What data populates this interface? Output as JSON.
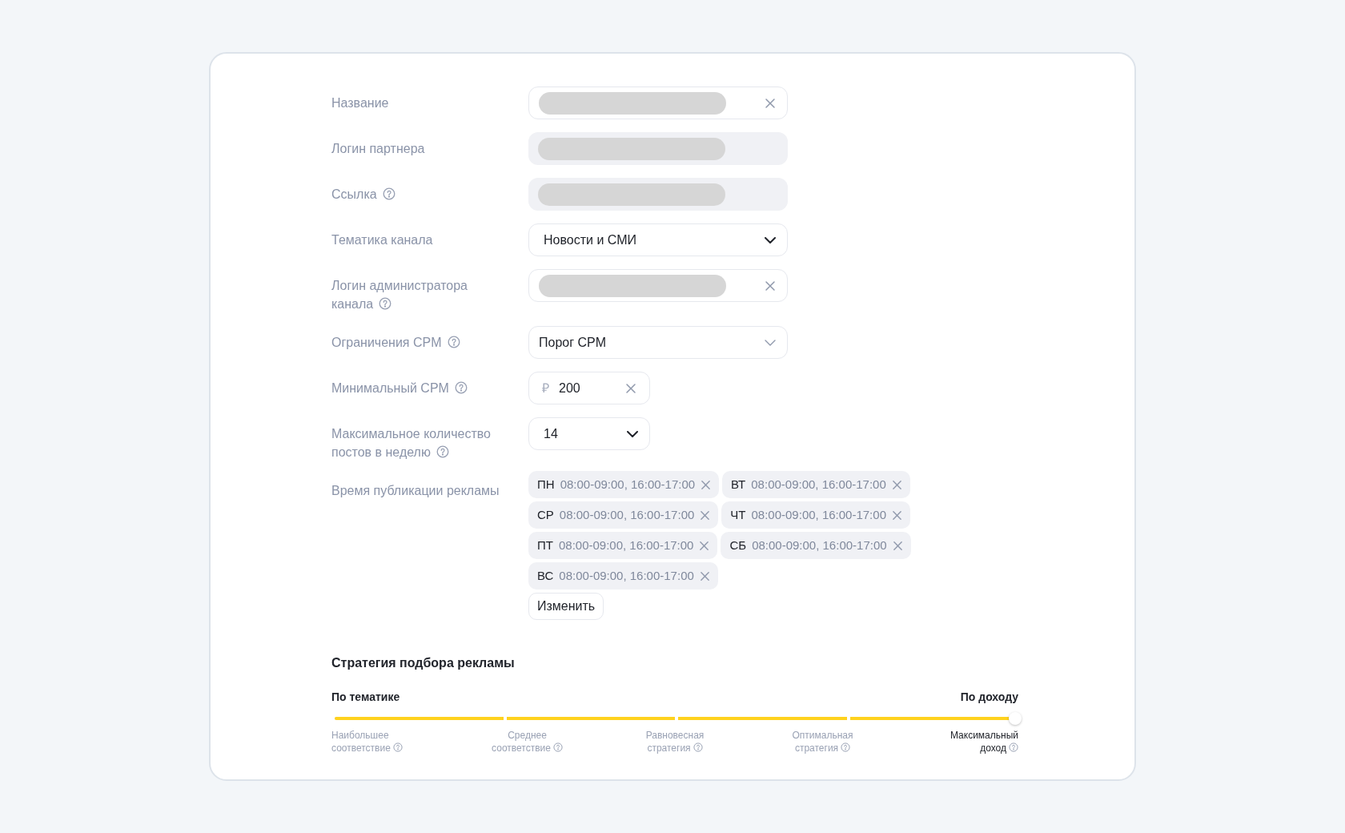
{
  "fields": [
    {
      "label": "Название",
      "help": false,
      "kind": "text",
      "clearable": true,
      "redacted": true
    },
    {
      "label": "Логин партнера",
      "help": false,
      "kind": "readonly",
      "redacted": true
    },
    {
      "label": "Ссылка",
      "help": true,
      "kind": "readonly",
      "redacted": true
    },
    {
      "label": "Тематика канала",
      "help": false,
      "kind": "select",
      "value": "Новости и СМИ"
    },
    {
      "label": "Логин администратора канала",
      "help": true,
      "kind": "text",
      "clearable": true,
      "redacted": true
    },
    {
      "label": "Ограничения CPM",
      "help": true,
      "kind": "plain-select",
      "value": "Порог CPM"
    },
    {
      "label": "Минимальный CPM",
      "help": true,
      "kind": "money",
      "currency": "₽",
      "value": "200",
      "clearable": true
    },
    {
      "label": "Максимальное количество постов в неделю",
      "help": true,
      "kind": "small-select",
      "value": "14"
    },
    {
      "label": "Время публикации рекламы",
      "help": false,
      "kind": "schedule",
      "chips": [
        {
          "day": "ПН",
          "times": "08:00-09:00, 16:00-17:00"
        },
        {
          "day": "ВТ",
          "times": "08:00-09:00, 16:00-17:00"
        },
        {
          "day": "СР",
          "times": "08:00-09:00, 16:00-17:00"
        },
        {
          "day": "ЧТ",
          "times": "08:00-09:00, 16:00-17:00"
        },
        {
          "day": "ПТ",
          "times": "08:00-09:00, 16:00-17:00"
        },
        {
          "day": "СБ",
          "times": "08:00-09:00, 16:00-17:00"
        },
        {
          "day": "ВС",
          "times": "08:00-09:00, 16:00-17:00"
        }
      ],
      "button": "Изменить"
    }
  ],
  "strategy": {
    "title": "Стратегия подбора рекламы",
    "left": "По тематике",
    "right": "По доходу",
    "level": 1,
    "options": [
      {
        "label": "Наибольшее соответствие",
        "selected": false
      },
      {
        "label": "Среднее соответствие",
        "selected": false
      },
      {
        "label": "Равновесная стратегия",
        "selected": false
      },
      {
        "label": "Оптимальная стратегия",
        "selected": false
      },
      {
        "label": "Максимальный доход",
        "selected": true
      }
    ]
  }
}
